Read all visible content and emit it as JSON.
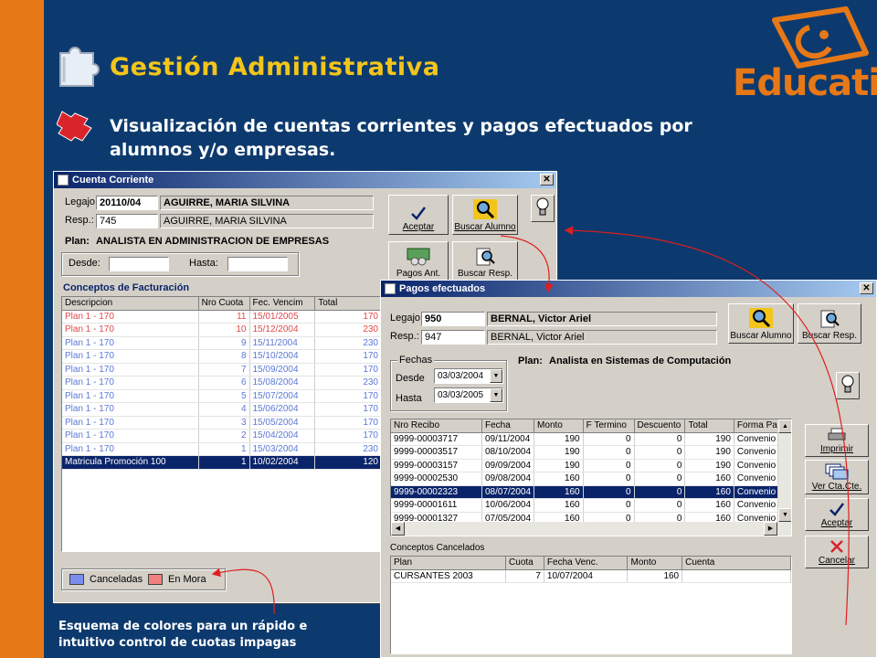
{
  "slide": {
    "title": "Gestión Administrativa",
    "subtitle": "Visualización de cuentas corrientes y pagos efectuados por alumnos y/o empresas.",
    "caption_line1": "Esquema de colores para un rápido e",
    "caption_line2": "intuitivo control de cuotas impagas",
    "logo_text": "Educatio",
    "logo_reg": "®",
    "colors": {
      "background": "#0d3a6e",
      "side_bar": "#e77817",
      "title": "#f3c51a",
      "logo": "#e77817"
    }
  },
  "cuenta_corriente": {
    "title": "Cuenta Corriente",
    "legajo_label": "Legajo:",
    "legajo_value": "20110/04",
    "legajo_name": "AGUIRRE, MARIA SILVINA",
    "resp_label": "Resp.:",
    "resp_value": "745",
    "resp_name": "AGUIRRE, MARIA SILVINA",
    "plan_label": "Plan:",
    "plan_value": "ANALISTA EN ADMINISTRACION DE EMPRESAS",
    "desde_label": "Desde:",
    "hasta_label": "Hasta:",
    "buttons": {
      "aceptar": "Aceptar",
      "buscar_alumno": "Buscar Alumno",
      "pagos_ant": "Pagos Ant.",
      "buscar_resp": "Buscar Resp."
    },
    "conceptos_title": "Conceptos de Facturación",
    "columns": [
      "Descripcion",
      "Nro Cuota",
      "Fec. Vencim",
      "Total"
    ],
    "rows": [
      {
        "desc": "Plan 1 - 170",
        "cuota": "11",
        "fecha": "15/01/2005",
        "total": "170",
        "state": "red"
      },
      {
        "desc": "Plan 1 - 170",
        "cuota": "10",
        "fecha": "15/12/2004",
        "total": "230",
        "state": "red"
      },
      {
        "desc": "Plan 1 - 170",
        "cuota": "9",
        "fecha": "15/11/2004",
        "total": "230",
        "state": "blue"
      },
      {
        "desc": "Plan 1 - 170",
        "cuota": "8",
        "fecha": "15/10/2004",
        "total": "170",
        "state": "blue"
      },
      {
        "desc": "Plan 1 - 170",
        "cuota": "7",
        "fecha": "15/09/2004",
        "total": "170",
        "state": "blue"
      },
      {
        "desc": "Plan 1 - 170",
        "cuota": "6",
        "fecha": "15/08/2004",
        "total": "230",
        "state": "blue"
      },
      {
        "desc": "Plan 1 - 170",
        "cuota": "5",
        "fecha": "15/07/2004",
        "total": "170",
        "state": "blue"
      },
      {
        "desc": "Plan 1 - 170",
        "cuota": "4",
        "fecha": "15/06/2004",
        "total": "170",
        "state": "blue"
      },
      {
        "desc": "Plan 1 - 170",
        "cuota": "3",
        "fecha": "15/05/2004",
        "total": "170",
        "state": "blue"
      },
      {
        "desc": "Plan 1 - 170",
        "cuota": "2",
        "fecha": "15/04/2004",
        "total": "170",
        "state": "blue"
      },
      {
        "desc": "Plan 1 - 170",
        "cuota": "1",
        "fecha": "15/03/2004",
        "total": "230",
        "state": "blue"
      },
      {
        "desc": "Matricula Promoción 100",
        "cuota": "1",
        "fecha": "10/02/2004",
        "total": "120",
        "state": "sel"
      }
    ],
    "legend": {
      "canceladas": "Canceladas",
      "en_mora": "En Mora",
      "canceladas_color": "#7b8ef0",
      "en_mora_color": "#f08080"
    }
  },
  "pagos": {
    "title": "Pagos efectuados",
    "legajo_label": "Legajo:",
    "legajo_value": "950",
    "legajo_name": "BERNAL, Victor Ariel",
    "resp_label": "Resp.:",
    "resp_value": "947",
    "resp_name": "BERNAL, Victor Ariel",
    "fechas_label": "Fechas",
    "desde_label": "Desde",
    "desde_value": "03/03/2004",
    "hasta_label": "Hasta",
    "hasta_value": "03/03/2005",
    "plan_label": "Plan:",
    "plan_value": "Analista en Sistemas de Computación",
    "buttons": {
      "buscar_alumno": "Buscar Alumno",
      "buscar_resp": "Buscar Resp.",
      "imprimir": "Imprimir",
      "ver_cta": "Ver Cta.Cte.",
      "aceptar": "Aceptar",
      "cancelar": "Cancelar"
    },
    "columns": [
      "Nro Recibo",
      "Fecha",
      "Monto",
      "F Termino",
      "Descuento",
      "Total",
      "Forma Pago"
    ],
    "rows": [
      {
        "recibo": "9999-00003717",
        "fecha": "09/11/2004",
        "monto": "190",
        "ftermino": "0",
        "desc": "0",
        "total": "190",
        "forma": "Convenio B",
        "sel": false
      },
      {
        "recibo": "9999-00003517",
        "fecha": "08/10/2004",
        "monto": "190",
        "ftermino": "0",
        "desc": "0",
        "total": "190",
        "forma": "Convenio B",
        "sel": false
      },
      {
        "recibo": "9999-00003157",
        "fecha": "09/09/2004",
        "monto": "190",
        "ftermino": "0",
        "desc": "0",
        "total": "190",
        "forma": "Convenio B",
        "sel": false
      },
      {
        "recibo": "9999-00002530",
        "fecha": "09/08/2004",
        "monto": "160",
        "ftermino": "0",
        "desc": "0",
        "total": "160",
        "forma": "Convenio B",
        "sel": false
      },
      {
        "recibo": "9999-00002323",
        "fecha": "08/07/2004",
        "monto": "160",
        "ftermino": "0",
        "desc": "0",
        "total": "160",
        "forma": "Convenio B",
        "sel": true
      },
      {
        "recibo": "9999-00001611",
        "fecha": "10/06/2004",
        "monto": "160",
        "ftermino": "0",
        "desc": "0",
        "total": "160",
        "forma": "Convenio B",
        "sel": false
      },
      {
        "recibo": "9999-00001327",
        "fecha": "07/05/2004",
        "monto": "160",
        "ftermino": "0",
        "desc": "0",
        "total": "160",
        "forma": "Convenio B",
        "sel": false
      }
    ],
    "cancelados_label": "Conceptos Cancelados",
    "cancelados_columns": [
      "Plan",
      "Cuota",
      "Fecha Venc.",
      "Monto",
      "Cuenta"
    ],
    "cancelados_rows": [
      {
        "plan": "CURSANTES 2003",
        "cuota": "7",
        "fecha": "10/07/2004",
        "monto": "160",
        "cuenta": ""
      }
    ]
  }
}
